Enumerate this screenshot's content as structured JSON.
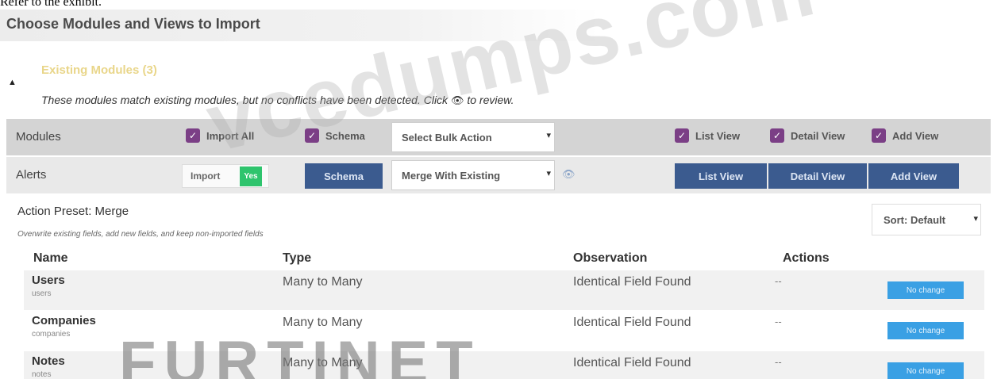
{
  "caption": "Refer to the exhibit.",
  "page_title": "Choose Modules and Views to Import",
  "section": {
    "toggle_icon": "caret-up-icon",
    "heading": "Existing Modules (3)",
    "description_pre": "These modules match existing modules, but no conflicts have been detected. Click",
    "eye_glyph": "👁",
    "description_post": "to review."
  },
  "modules_bar": {
    "label": "Modules",
    "import_all": "Import All",
    "schema": "Schema",
    "bulk_action": "Select Bulk Action",
    "list_view": "List View",
    "detail_view": "Detail View",
    "add_view": "Add View"
  },
  "alerts_bar": {
    "label": "Alerts",
    "import_label": "Import",
    "import_value": "Yes",
    "schema_button": "Schema",
    "merge_select": "Merge With Existing",
    "list_view_button": "List View",
    "detail_view_button": "Detail View",
    "add_view_button": "Add View"
  },
  "action_preset": {
    "title": "Action Preset: Merge",
    "description": "Overwrite existing fields, add new fields, and keep non-imported fields"
  },
  "sort": "Sort: Default",
  "table": {
    "columns": [
      "Name",
      "Type",
      "Observation",
      "Actions"
    ],
    "rows": [
      {
        "name": "Users",
        "sub": "users",
        "type": "Many to Many",
        "observation": "Identical Field Found",
        "actions": "--",
        "status": "No change"
      },
      {
        "name": "Companies",
        "sub": "companies",
        "type": "Many to Many",
        "observation": "Identical Field Found",
        "actions": "--",
        "status": "No change"
      },
      {
        "name": "Notes",
        "sub": "notes",
        "type": "Many to Many",
        "observation": "Identical Field Found",
        "actions": "--",
        "status": "No change"
      }
    ]
  },
  "watermarks": {
    "site": "vcedumps.com",
    "brand": "FURTINET",
    "reg": "®"
  },
  "colors": {
    "checkbox": "#7b3f86",
    "button": "#3b5b8f",
    "yes": "#2ec46d",
    "no_change": "#3aa0e4",
    "section_heading": "#e9d68a"
  }
}
